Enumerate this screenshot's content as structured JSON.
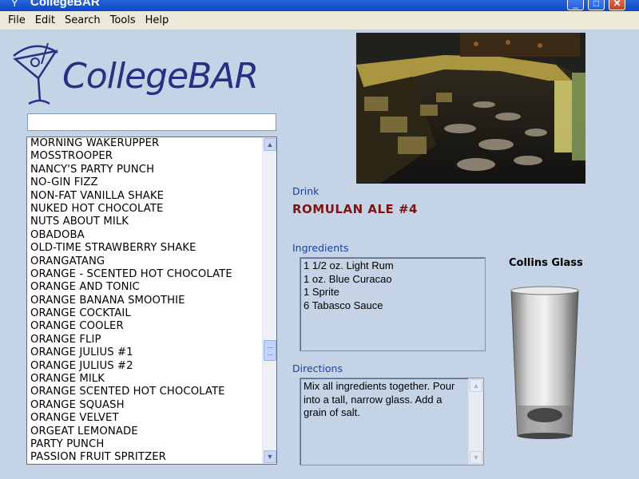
{
  "window": {
    "title": "CollegeBAR",
    "minimize_symbol": "_",
    "maximize_symbol": "□",
    "close_symbol": "✕"
  },
  "menu": [
    "File",
    "Edit",
    "Search",
    "Tools",
    "Help"
  ],
  "logo": {
    "text": "CollegeBAR",
    "icon": "martini-glass-icon"
  },
  "search": {
    "value": "",
    "placeholder": ""
  },
  "drink_list": [
    "MORNING WAKERUPPER",
    "MOSSTROOPER",
    "NANCY'S PARTY PUNCH",
    "NO-GIN FIZZ",
    "NON-FAT VANILLA SHAKE",
    "NUKED HOT CHOCOLATE",
    "NUTS ABOUT MILK",
    "OBADOBA",
    "OLD-TIME STRAWBERRY SHAKE",
    "ORANGATANG",
    "ORANGE - SCENTED HOT CHOCOLATE",
    "ORANGE AND TONIC",
    "ORANGE BANANA SMOOTHIE",
    "ORANGE COCKTAIL",
    "ORANGE COOLER",
    "ORANGE FLIP",
    "ORANGE JULIUS #1",
    "ORANGE JULIUS #2",
    "ORANGE MILK",
    "ORANGE SCENTED HOT CHOCOLATE",
    "ORANGE SQUASH",
    "ORANGE VELVET",
    "ORGEAT LEMONADE",
    "PARTY PUNCH",
    "PASSION FRUIT SPRITZER"
  ],
  "scroll_arrows": {
    "up": "▲",
    "down": "▼"
  },
  "drink": {
    "label": "Drink",
    "name": "ROMULAN ALE #4"
  },
  "ingredients": {
    "label": "Ingredients",
    "items": [
      "1 1/2 oz. Light Rum",
      "1 oz. Blue Curacao",
      "1 Sprite",
      "6 Tabasco Sauce"
    ]
  },
  "directions": {
    "label": "Directions",
    "text": "Mix all ingredients together. Pour into a tall, narrow glass. Add a grain of salt."
  },
  "glass": {
    "label": "Collins Glass",
    "icon": "collins-glass-icon"
  },
  "colors": {
    "client_bg": "#c4d3e6",
    "logo_text": "#2b2f82",
    "section_label": "#1c3fa0",
    "drink_name": "#7a1512"
  }
}
